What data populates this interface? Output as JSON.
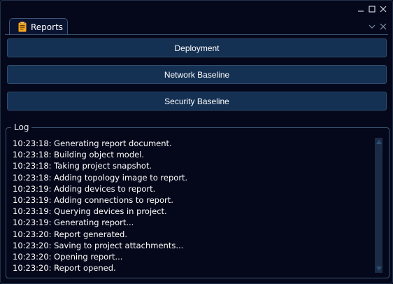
{
  "window": {
    "controls": {
      "minimize_icon": "minimize-icon",
      "maximize_icon": "maximize-icon",
      "close_icon": "close-icon"
    }
  },
  "tab": {
    "label": "Reports",
    "icon": "clipboard-icon",
    "accent_color": "#f5a623"
  },
  "buttons": {
    "deployment": "Deployment",
    "network_baseline": "Network Baseline",
    "security_baseline": "Security Baseline"
  },
  "log": {
    "title": "Log",
    "lines": [
      "10:23:18: Generating report document.",
      "10:23:18: Building object model.",
      "10:23:18: Taking project snapshot.",
      "10:23:18: Adding topology image to report.",
      "10:23:19: Adding devices to report.",
      "10:23:19: Adding connections to report.",
      "10:23:19: Querying devices in project.",
      "10:23:19: Generating report...",
      "10:23:20: Report generated.",
      "10:23:20: Saving to project attachments...",
      "10:23:20: Opening report...",
      "10:23:20: Report opened."
    ]
  },
  "colors": {
    "background": "#05081a",
    "button_bg": "#143052",
    "border": "#3b5575"
  }
}
